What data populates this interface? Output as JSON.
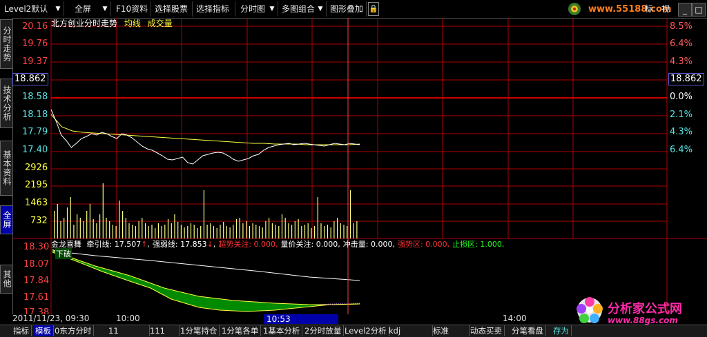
{
  "toolbar": {
    "items": [
      "Level2默认",
      "全屏",
      "F10资料",
      "选择股票",
      "选择指标",
      "分时图",
      "多图组合",
      "图形叠加"
    ],
    "right_items": [
      "标",
      "视"
    ],
    "site_logo_text": "www.55188.com",
    "window_buttons": [
      "_",
      "□",
      "×"
    ]
  },
  "left_tabs": [
    "分时走势",
    "技术分析",
    "基本资料",
    "全屏",
    "其他"
  ],
  "active_left_tab": "全屏",
  "chart_header": {
    "title": "北方创业分时走势",
    "legend_avg": "均线",
    "legend_vol": "成交量"
  },
  "price_axis_left": [
    "20.16",
    "19.76",
    "19.37",
    "18.58",
    "18.18",
    "17.79",
    "17.40"
  ],
  "price_axis_current": "18.862",
  "pct_axis_right": [
    "8.5%",
    "6.4%",
    "4.3%",
    "0.0%",
    "2.1%",
    "4.3%",
    "6.4%"
  ],
  "volume_axis": [
    "2926",
    "2195",
    "1463",
    "732"
  ],
  "indicator_axis": [
    "18.30",
    "18.07",
    "17.84",
    "17.61",
    "17.38"
  ],
  "indicator_header": {
    "name": "金龙喜舞",
    "items": [
      {
        "label": "牵引线",
        "value": "17.507",
        "arrow": "↑",
        "color": "#ffffff"
      },
      {
        "label": "强弱线",
        "value": "17.853",
        "arrow": "↓",
        "color": "#ffffff"
      },
      {
        "label": "超势关注",
        "value": "0.000",
        "arrow": "",
        "color": "#ff3030"
      },
      {
        "label": "量价关注",
        "value": "0.000",
        "arrow": "",
        "color": "#ffffff"
      },
      {
        "label": "冲击量",
        "value": "0.000",
        "arrow": "",
        "color": "#ffffff"
      },
      {
        "label": "强势区",
        "value": "0.000",
        "arrow": "",
        "color": "#ff3030"
      },
      {
        "label": "止损区",
        "value": "1.000",
        "arrow": "",
        "color": "#20ff20"
      }
    ],
    "note_label": "下破"
  },
  "time_axis": {
    "start": "2011/11/23, 09:30",
    "t1000": "10:00",
    "cursor": "10:53",
    "t1400": "14:00"
  },
  "bottom_tabs": [
    "指标",
    "模板",
    "0东方分时",
    "11",
    "111",
    "1分笔持仓",
    "1分笔各单",
    "1基本分析",
    "2分时放量",
    "Level2分析",
    "kdj",
    "标准",
    "动态买卖",
    "分笔看盘",
    "存为"
  ],
  "active_bottom_tab": "模板",
  "watermark": {
    "title": "分析家公式网",
    "url": "www.88gs.com"
  },
  "colors": {
    "grid_red": "#b00000",
    "price_line": "#ffffff",
    "avg_line": "#ffff40",
    "volume_bar": "#ffff80",
    "indicator_fill": "#008a00",
    "highlight": "#0000a8"
  }
}
